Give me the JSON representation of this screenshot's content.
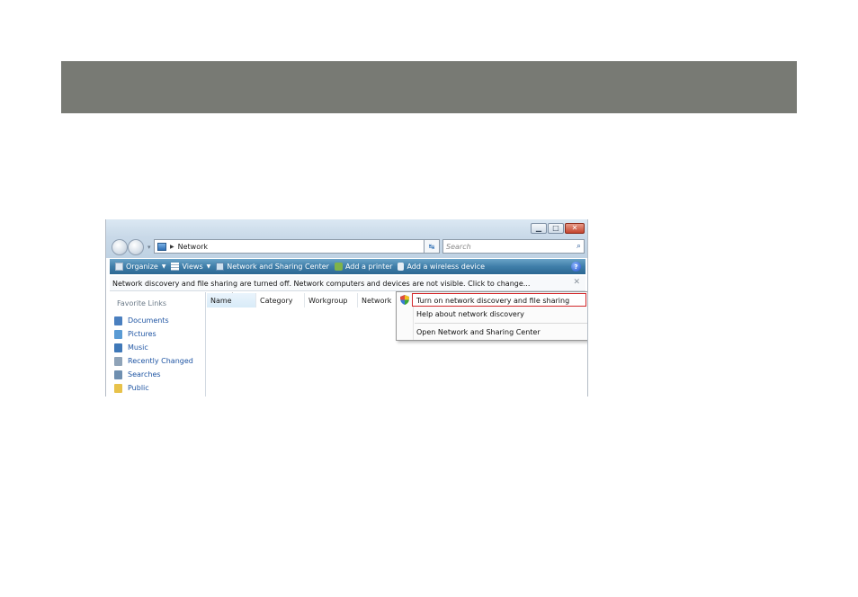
{
  "window": {
    "address": "Network",
    "search_placeholder": "Search"
  },
  "toolbar": {
    "organize": "Organize",
    "views": "Views",
    "network_sharing_center": "Network and Sharing Center",
    "add_printer": "Add a printer",
    "add_wireless": "Add a wireless device"
  },
  "infobar": {
    "text": "Network discovery and file sharing are turned off. Network computers and devices are not visible. Click to change..."
  },
  "navpane": {
    "title": "Favorite Links",
    "items": [
      {
        "label": "Documents",
        "icon": "documents-icon",
        "color": "#4a7fbf"
      },
      {
        "label": "Pictures",
        "icon": "pictures-icon",
        "color": "#5a9bd4"
      },
      {
        "label": "Music",
        "icon": "music-icon",
        "color": "#3f78b8"
      },
      {
        "label": "Recently Changed",
        "icon": "recent-icon",
        "color": "#8fa3b8"
      },
      {
        "label": "Searches",
        "icon": "searches-icon",
        "color": "#6f8fb0"
      },
      {
        "label": "Public",
        "icon": "public-folder-icon",
        "color": "#e8c24a"
      }
    ]
  },
  "columns": {
    "name": "Name",
    "category": "Category",
    "workgroup": "Workgroup",
    "network_location": "Network lo"
  },
  "context_menu": {
    "item1": "Turn on network discovery and file sharing",
    "item2": "Help about network discovery",
    "item3": "Open Network and Sharing Center"
  },
  "colors": {
    "header_band": "#787a74",
    "highlight_border": "#d2282b",
    "link_blue": "#1f55a3"
  }
}
